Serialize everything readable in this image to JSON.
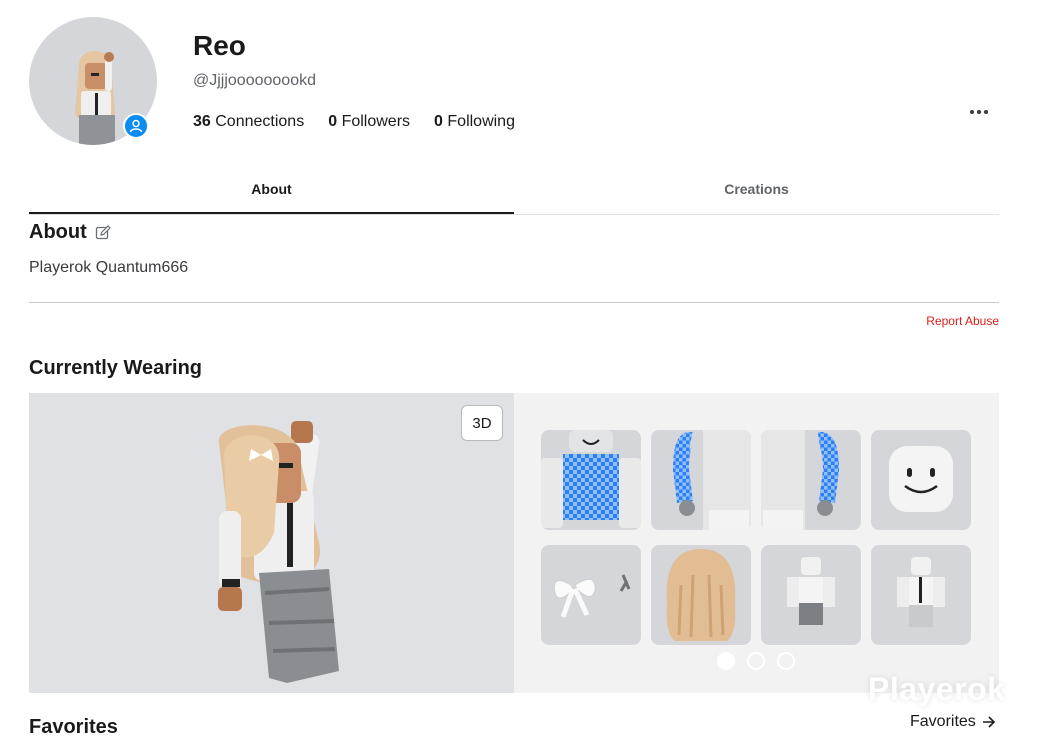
{
  "profile": {
    "display_name": "Reo",
    "username": "@Jjjjooooooookd",
    "stats": [
      {
        "count": "36",
        "label": "Connections"
      },
      {
        "count": "0",
        "label": "Followers"
      },
      {
        "count": "0",
        "label": "Following"
      }
    ]
  },
  "tabs": [
    {
      "label": "About",
      "active": true
    },
    {
      "label": "Creations",
      "active": false
    }
  ],
  "about": {
    "title": "About",
    "text": "Playerok Quantum666",
    "report_label": "Report Abuse"
  },
  "wearing": {
    "title": "Currently Wearing",
    "view_toggle": "3D",
    "items": [
      {
        "icon": "checkered-shirt-icon"
      },
      {
        "icon": "checkered-sleeves-left-icon"
      },
      {
        "icon": "checkered-sleeves-right-icon"
      },
      {
        "icon": "smile-face-icon"
      },
      {
        "icon": "hair-bow-icon"
      },
      {
        "icon": "blonde-hair-icon"
      },
      {
        "icon": "pants-outfit-icon"
      },
      {
        "icon": "shirt-tie-outfit-icon"
      }
    ],
    "pagination": {
      "pages": 3,
      "current": 1
    }
  },
  "favorites": {
    "title": "Favorites",
    "link_label": "Favorites"
  },
  "watermark": "Playerok",
  "colors": {
    "accent_blue": "#0a8cf0",
    "report_red": "#d4201c",
    "stage_bg": "#dfe1e4",
    "tile_bg": "#d5d6d9",
    "checker_blue": "#2f7ff0"
  }
}
